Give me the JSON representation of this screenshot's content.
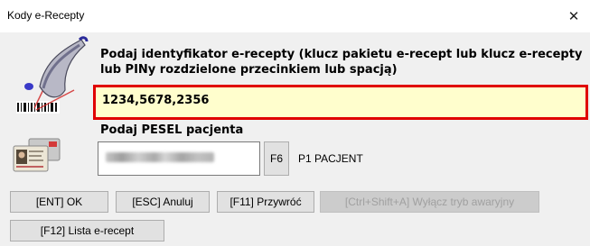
{
  "window": {
    "title": "Kody e-Recepty",
    "close_glyph": "✕"
  },
  "icons": {
    "scanner": "barcode-scanner-icon",
    "id_card": "id-card-icon",
    "close": "close-icon"
  },
  "code_section": {
    "label": "Podaj identyfikator e-recepty (klucz pakietu e-recept lub klucz e-recepty lub PINy rozdzielone przecinkiem lub spacją)",
    "value": "1234,5678,2356"
  },
  "pesel_section": {
    "label": "Podaj PESEL pacjenta",
    "f6_label": "F6",
    "patient_name": "P1 PACJENT"
  },
  "buttons": {
    "ok": "[ENT] OK",
    "cancel": "[ESC] Anuluj",
    "restore": "[F11] Przywróć",
    "emergency": "[Ctrl+Shift+A] Wyłącz tryb awaryjny",
    "list": "[F12] Lista e-recept"
  },
  "colors": {
    "highlight_border": "#e00000",
    "input_bg": "#fffecd",
    "window_bg": "#f0f0f0"
  }
}
